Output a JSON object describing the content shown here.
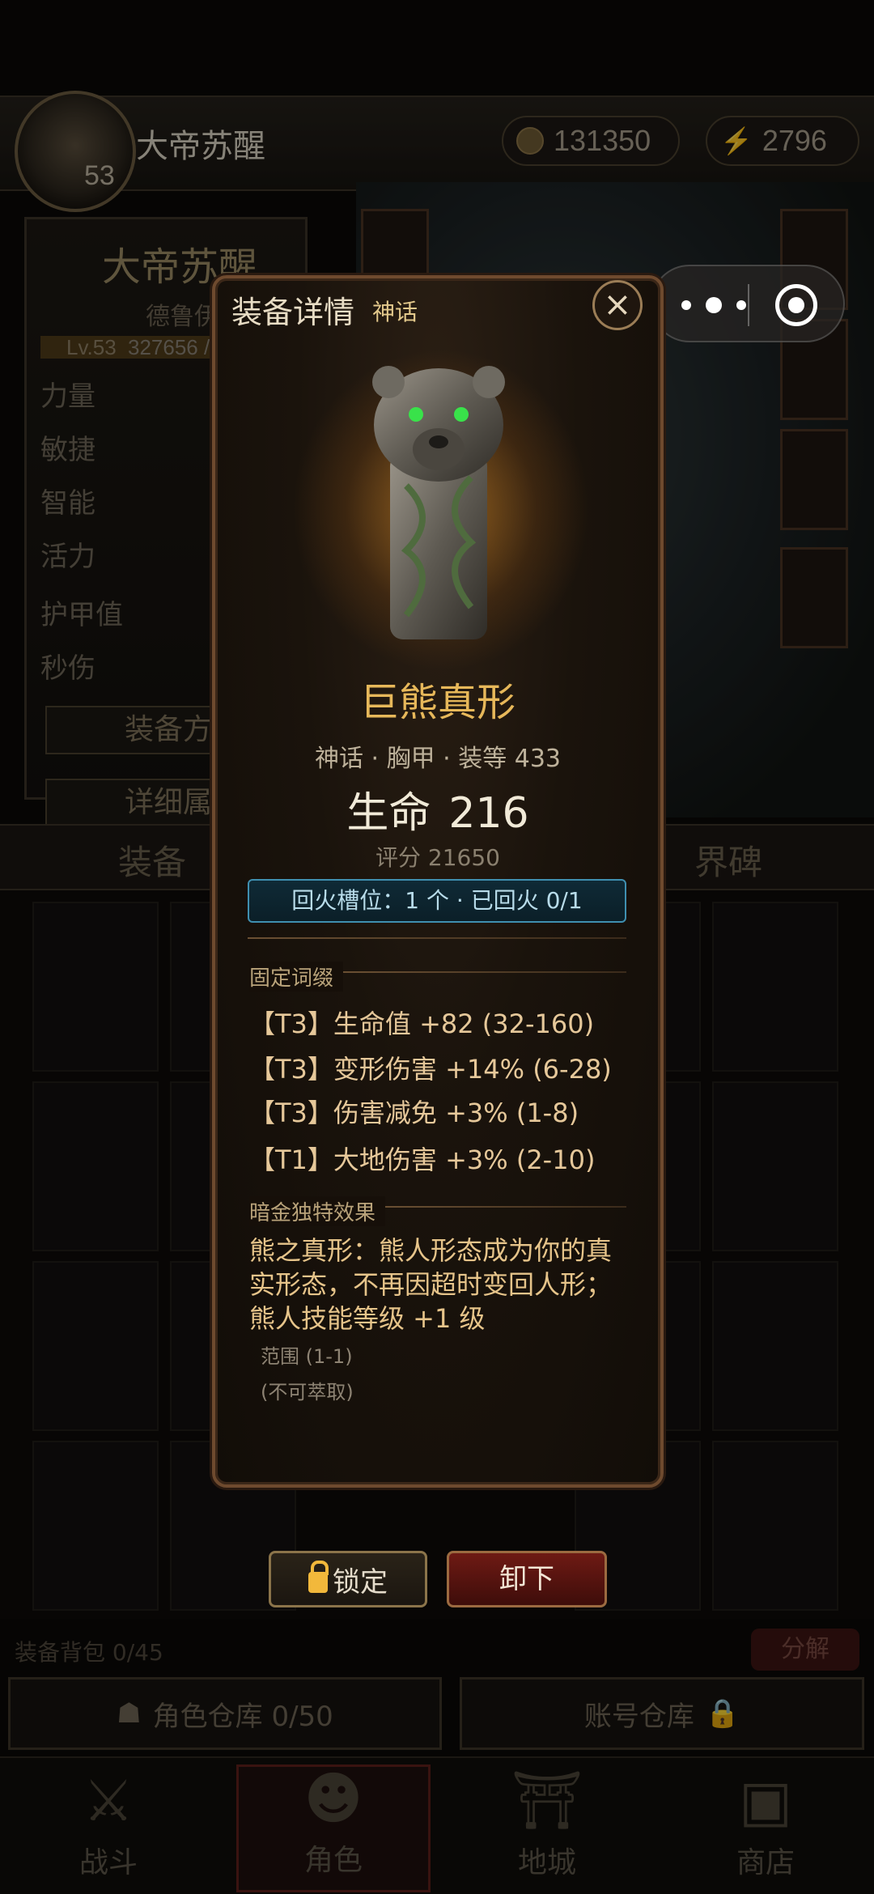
{
  "player": {
    "name": "大帝苏醒",
    "level": "53"
  },
  "resources": {
    "gold": "131350",
    "energy": "2796"
  },
  "character": {
    "name": "大帝苏醒",
    "class": "德鲁伊",
    "level_label": "Lv.53",
    "exp": "327656 /",
    "stats": [
      "力量",
      "敏捷",
      "智能",
      "活力",
      "护甲值",
      "秒伤"
    ],
    "buttons": [
      "装备方",
      "详细属"
    ]
  },
  "tabs": {
    "left": "装备",
    "right": "界碑"
  },
  "inventory": {
    "bag_label": "装备背包 0/45",
    "decompose": "分解",
    "char_storage": "角色仓库 0/50",
    "account_storage": "账号仓库"
  },
  "nav": [
    {
      "label": "战斗",
      "icon": "crossed-swords-icon"
    },
    {
      "label": "角色",
      "icon": "character-icon"
    },
    {
      "label": "地城",
      "icon": "dungeon-gate-icon"
    },
    {
      "label": "商店",
      "icon": "shop-chest-icon"
    }
  ],
  "modal": {
    "title": "装备详情",
    "tier": "神话",
    "item_name": "巨熊真形",
    "meta": "神话 · 胸甲 · 装等 433",
    "main_stat_name": "生命",
    "main_stat_value": "216",
    "score": "评分 21650",
    "socket": "回火槽位：1 个 · 已回火 0/1",
    "fixed_label": "固定词缀",
    "affixes": [
      "【T3】生命值 +82 (32-160)",
      "【T3】变形伤害 +14% (6-28)",
      "【T3】伤害减免 +3% (1-8)",
      "【T1】大地伤害 +3% (2-10)"
    ],
    "unique_label": "暗金独特效果",
    "unique_effect": "熊之真形：熊人形态成为你的真实形态，不再因超时变回人形；熊人技能等级 +1 级",
    "range": "范围 (1-1)",
    "extract": "(不可萃取)",
    "lock_label": "锁定",
    "unequip_label": "卸下"
  },
  "colors": {
    "mythic_gold": "#e7b85a",
    "socket_blue": "#3f8fb0",
    "danger_red": "#6e1a14"
  }
}
